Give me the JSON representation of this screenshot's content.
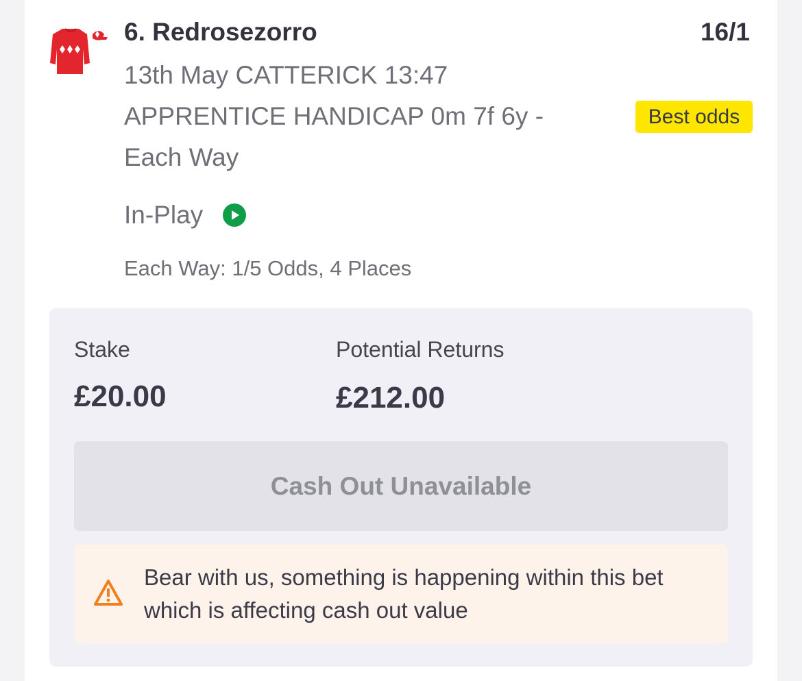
{
  "selection": {
    "runner": "6. Redrosezorro",
    "odds": "16/1",
    "race_info": "13th May CATTERICK 13:47 APPRENTICE HANDICAP 0m 7f 6y - Each Way",
    "best_odds_badge": "Best odds",
    "status": "In-Play",
    "each_way_terms": "Each Way: 1/5 Odds, 4 Places",
    "silks_icon": "red-jockey-silks-white-diamonds-icon",
    "inplay_icon": "play-circle-icon"
  },
  "bet": {
    "stake_label": "Stake",
    "stake_value": "£20.00",
    "returns_label": "Potential Returns",
    "returns_value": "£212.00",
    "cashout_label": "Cash Out Unavailable",
    "warning_text": "Bear with us, something is happening within this bet which is affecting cash out value",
    "warning_icon": "warning-triangle-icon"
  },
  "colors": {
    "badge": "#ffe600",
    "inplay": "#0f9d48",
    "warning": "#f07f1e",
    "silks": "#e3262d"
  }
}
